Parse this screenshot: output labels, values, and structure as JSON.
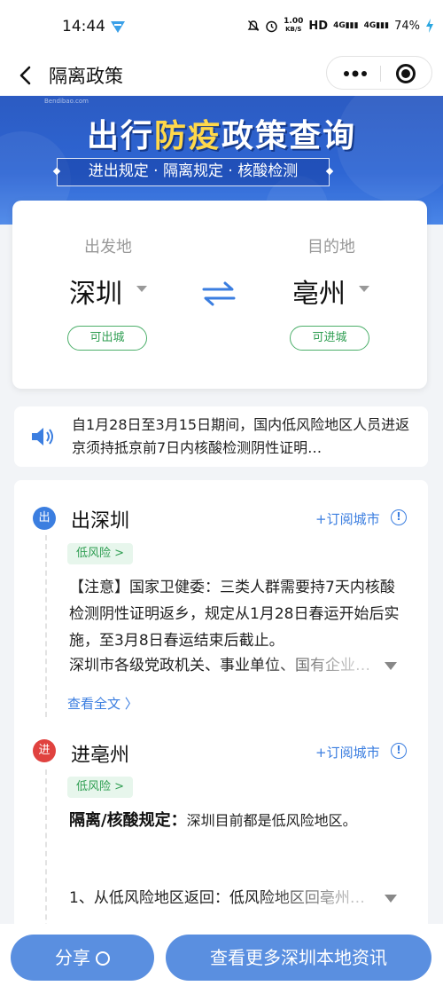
{
  "status_bar": {
    "time": "14:44",
    "speed_value": "1.00",
    "speed_unit": "KB/S",
    "network": "HD",
    "signal1": "4G",
    "signal2": "4G",
    "battery": "74%"
  },
  "nav": {
    "title": "隔离政策",
    "more_icon": "more-dots-icon",
    "close_icon": "target-icon"
  },
  "banner": {
    "watermark": "Bendibao.com",
    "title_part1": "出行",
    "title_highlight": "防疫",
    "title_part2": "政策查询",
    "subtitle": "进出规定 · 隔离规定 · 核酸检测",
    "accent": "#2e66d4",
    "highlight_color": "#ffd84a"
  },
  "route": {
    "from_label": "出发地",
    "from_city": "深圳",
    "from_status": "可出城",
    "to_label": "目的地",
    "to_city": "亳州",
    "to_status": "可进城",
    "status_color": "#2f9e52"
  },
  "notice": {
    "icon": "speaker-icon",
    "text": "自1月28日至3月15日期间，国内低风险地区人员进返京须持抵京前7日内核酸检测阴性证明…"
  },
  "depart_section": {
    "badge": "出",
    "title": "出深圳",
    "subscribe": "+订阅城市",
    "info": "!",
    "risk": "低风险 >",
    "text": "【注意】国家卫健委：三类人群需要持7天内核酸检测阴性证明返乡，规定从1月28日春运开始后实施，至3月8日春运结束后截止。",
    "truncated": "深圳市各级党政机关、事业单位、国有企业…",
    "read_more": "查看全文 〉"
  },
  "arrive_section": {
    "badge": "进",
    "title": "进亳州",
    "subscribe": "+订阅城市",
    "info": "!",
    "risk": "低风险 >",
    "rule_label": "隔离/核酸规定：",
    "rule_text": "深圳目前都是低风险地区。",
    "item1": "1、从低风险地区返回：低风险地区回亳州…"
  },
  "bottom": {
    "share": "分享",
    "more": "查看更多深圳本地资讯",
    "button_color": "#5a8fe0"
  }
}
